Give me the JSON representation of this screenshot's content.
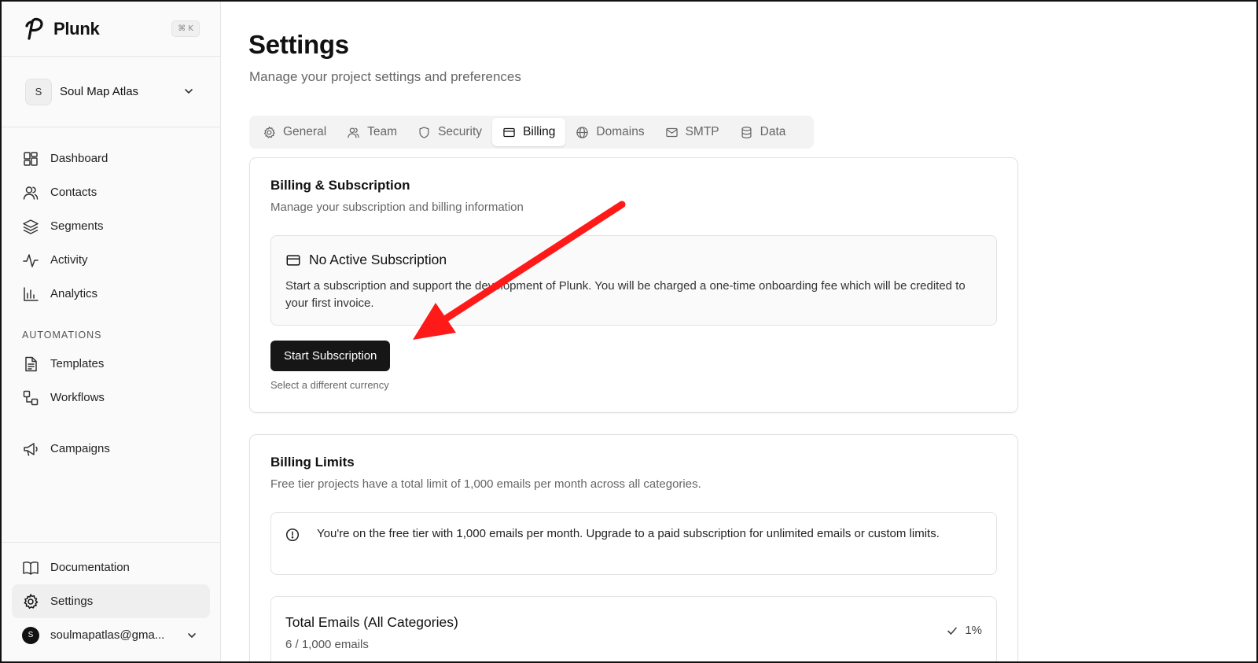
{
  "app": {
    "brand": "Plunk",
    "shortcut": "⌘ K"
  },
  "project": {
    "initial": "S",
    "name": "Soul Map Atlas"
  },
  "sidebar": {
    "items": [
      {
        "label": "Dashboard",
        "icon": "dashboard-icon"
      },
      {
        "label": "Contacts",
        "icon": "users-icon"
      },
      {
        "label": "Segments",
        "icon": "layers-icon"
      },
      {
        "label": "Activity",
        "icon": "activity-icon"
      },
      {
        "label": "Analytics",
        "icon": "bar-chart-icon"
      }
    ],
    "section_label": "AUTOMATIONS",
    "automation_items": [
      {
        "label": "Templates",
        "icon": "file-icon"
      },
      {
        "label": "Workflows",
        "icon": "workflow-icon"
      }
    ],
    "campaigns_label": "Campaigns",
    "bottom_items": [
      {
        "label": "Documentation",
        "icon": "book-icon"
      },
      {
        "label": "Settings",
        "icon": "gear-icon"
      }
    ],
    "user": {
      "initial": "S",
      "email": "soulmapatlas@gma..."
    }
  },
  "page": {
    "title": "Settings",
    "subtitle": "Manage your project settings and preferences"
  },
  "tabs": [
    {
      "label": "General",
      "icon": "gear-icon"
    },
    {
      "label": "Team",
      "icon": "users-icon"
    },
    {
      "label": "Security",
      "icon": "shield-icon"
    },
    {
      "label": "Billing",
      "icon": "credit-card-icon",
      "active": true
    },
    {
      "label": "Domains",
      "icon": "globe-icon"
    },
    {
      "label": "SMTP",
      "icon": "mail-icon"
    },
    {
      "label": "Data",
      "icon": "database-icon"
    }
  ],
  "billing": {
    "title": "Billing & Subscription",
    "subtitle": "Manage your subscription and billing information",
    "notice_title": "No Active Subscription",
    "notice_body": "Start a subscription and support the development of Plunk. You will be charged a one-time onboarding fee which will be credited to your first invoice.",
    "button": "Start Subscription",
    "currency_link": "Select a different currency"
  },
  "limits": {
    "title": "Billing Limits",
    "subtitle": "Free tier projects have a total limit of 1,000 emails per month across all categories.",
    "info": "You're on the free tier with 1,000 emails per month. Upgrade to a paid subscription for unlimited emails or custom limits.",
    "usage_title": "Total Emails (All Categories)",
    "usage_sub": "6 / 1,000 emails",
    "usage_percent": "1%"
  },
  "annotation": {
    "arrow_color": "#ff1a1a"
  }
}
